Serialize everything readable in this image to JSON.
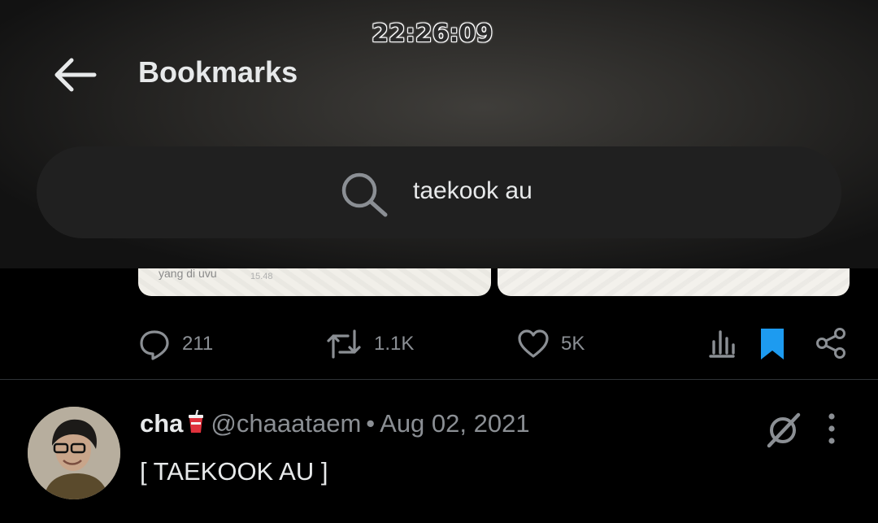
{
  "status_bar": {
    "time": "22:26:09"
  },
  "header": {
    "title": "Bookmarks"
  },
  "search": {
    "value": "taekook au"
  },
  "media": {
    "snippet": "yang di uvu",
    "snippet_time": "15.48"
  },
  "actions": {
    "replies": "211",
    "reposts": "1.1K",
    "likes": "5K"
  },
  "tweet": {
    "name": "cha",
    "name_emoji": "cup-with-straw",
    "handle": "@chaaataem",
    "separator": "•",
    "date": "Aug 02, 2021",
    "text": "[ TAEKOOK AU ]"
  },
  "colors": {
    "bookmark_accent": "#1d9bf0",
    "text_primary": "#e7e9ea",
    "text_secondary": "#8b8f94"
  }
}
